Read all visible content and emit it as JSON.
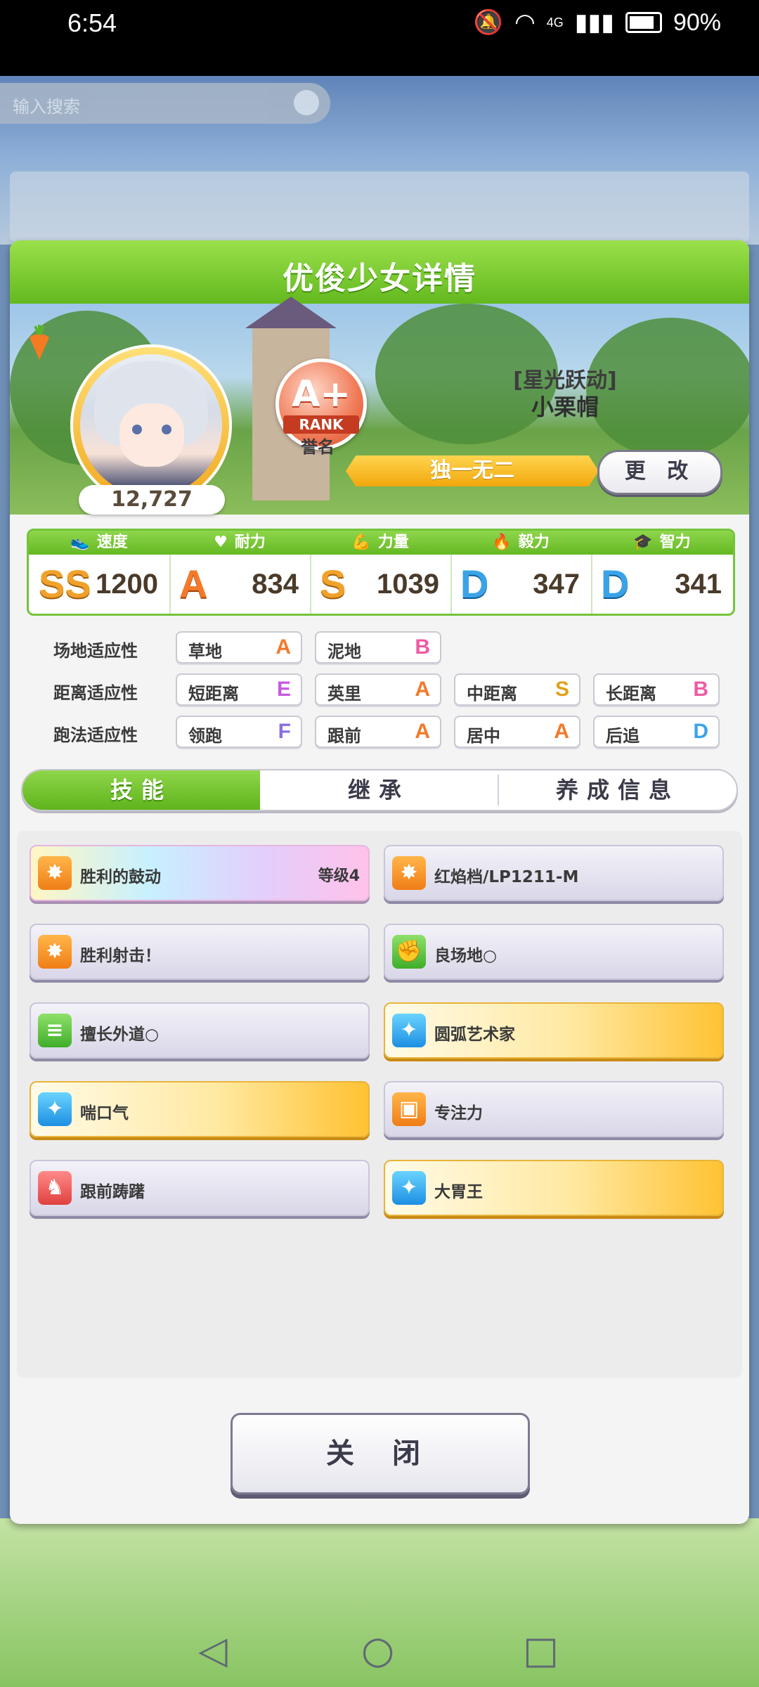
{
  "status_bar": {
    "time": "6:54",
    "network": "4G",
    "battery": "90%"
  },
  "background": {
    "search_text": "输入搜索"
  },
  "panel": {
    "title": "优俊少女详情"
  },
  "character": {
    "fans": "12,727",
    "rank_grade": "A+",
    "rank_ribbon": "RANK",
    "rank_label": "誉名",
    "epithet": "[星光跃动]",
    "name": "小栗帽",
    "title_banner": "独一无二",
    "change_button": "更 改"
  },
  "stats": [
    {
      "label": "速度",
      "grade": "SS",
      "value": "1200",
      "icon": "shoe-icon"
    },
    {
      "label": "耐力",
      "grade": "A",
      "value": "834",
      "icon": "heart-icon"
    },
    {
      "label": "力量",
      "grade": "S",
      "value": "1039",
      "icon": "muscle-icon"
    },
    {
      "label": "毅力",
      "grade": "D",
      "value": "347",
      "icon": "flame-icon"
    },
    {
      "label": "智力",
      "grade": "D",
      "value": "341",
      "icon": "graduation-cap-icon"
    }
  ],
  "aptitudes": {
    "surface": {
      "label": "场地适应性",
      "items": [
        {
          "name": "草地",
          "grade": "A"
        },
        {
          "name": "泥地",
          "grade": "B"
        }
      ]
    },
    "distance": {
      "label": "距离适应性",
      "items": [
        {
          "name": "短距离",
          "grade": "E"
        },
        {
          "name": "英里",
          "grade": "A"
        },
        {
          "name": "中距离",
          "grade": "S"
        },
        {
          "name": "长距离",
          "grade": "B"
        }
      ]
    },
    "strategy": {
      "label": "跑法适应性",
      "items": [
        {
          "name": "领跑",
          "grade": "F"
        },
        {
          "name": "跟前",
          "grade": "A"
        },
        {
          "name": "居中",
          "grade": "A"
        },
        {
          "name": "后追",
          "grade": "D"
        }
      ]
    }
  },
  "tabs": [
    {
      "label": "技能",
      "active": true
    },
    {
      "label": "继承",
      "active": false
    },
    {
      "label": "养成信息",
      "active": false
    }
  ],
  "skills": [
    {
      "name": "胜利的鼓动",
      "level": "等级4",
      "style": "rainbow",
      "icon": "burst-icon"
    },
    {
      "name": "红焰档/LP1211-M",
      "level": "",
      "style": "grey",
      "icon": "burst-icon"
    },
    {
      "name": "胜利射击！",
      "level": "",
      "style": "grey",
      "icon": "burst-icon"
    },
    {
      "name": "良场地○",
      "level": "",
      "style": "grey",
      "icon": "muscle-icon"
    },
    {
      "name": "擅长外道○",
      "level": "",
      "style": "grey",
      "icon": "track-icon"
    },
    {
      "name": "圆弧艺术家",
      "level": "",
      "style": "gold",
      "icon": "sparkle-icon"
    },
    {
      "name": "喘口气",
      "level": "",
      "style": "gold",
      "icon": "sparkle-icon"
    },
    {
      "name": "专注力",
      "level": "",
      "style": "grey",
      "icon": "gate-icon"
    },
    {
      "name": "跟前踌躇",
      "level": "",
      "style": "grey",
      "icon": "horse-icon"
    },
    {
      "name": "大胃王",
      "level": "",
      "style": "gold",
      "icon": "sparkle-icon"
    }
  ],
  "close_button": "关 闭",
  "colors": {
    "accent_green": "#6bc12a",
    "gold": "#f2a70c",
    "panel_bg": "#f4f4f4"
  }
}
